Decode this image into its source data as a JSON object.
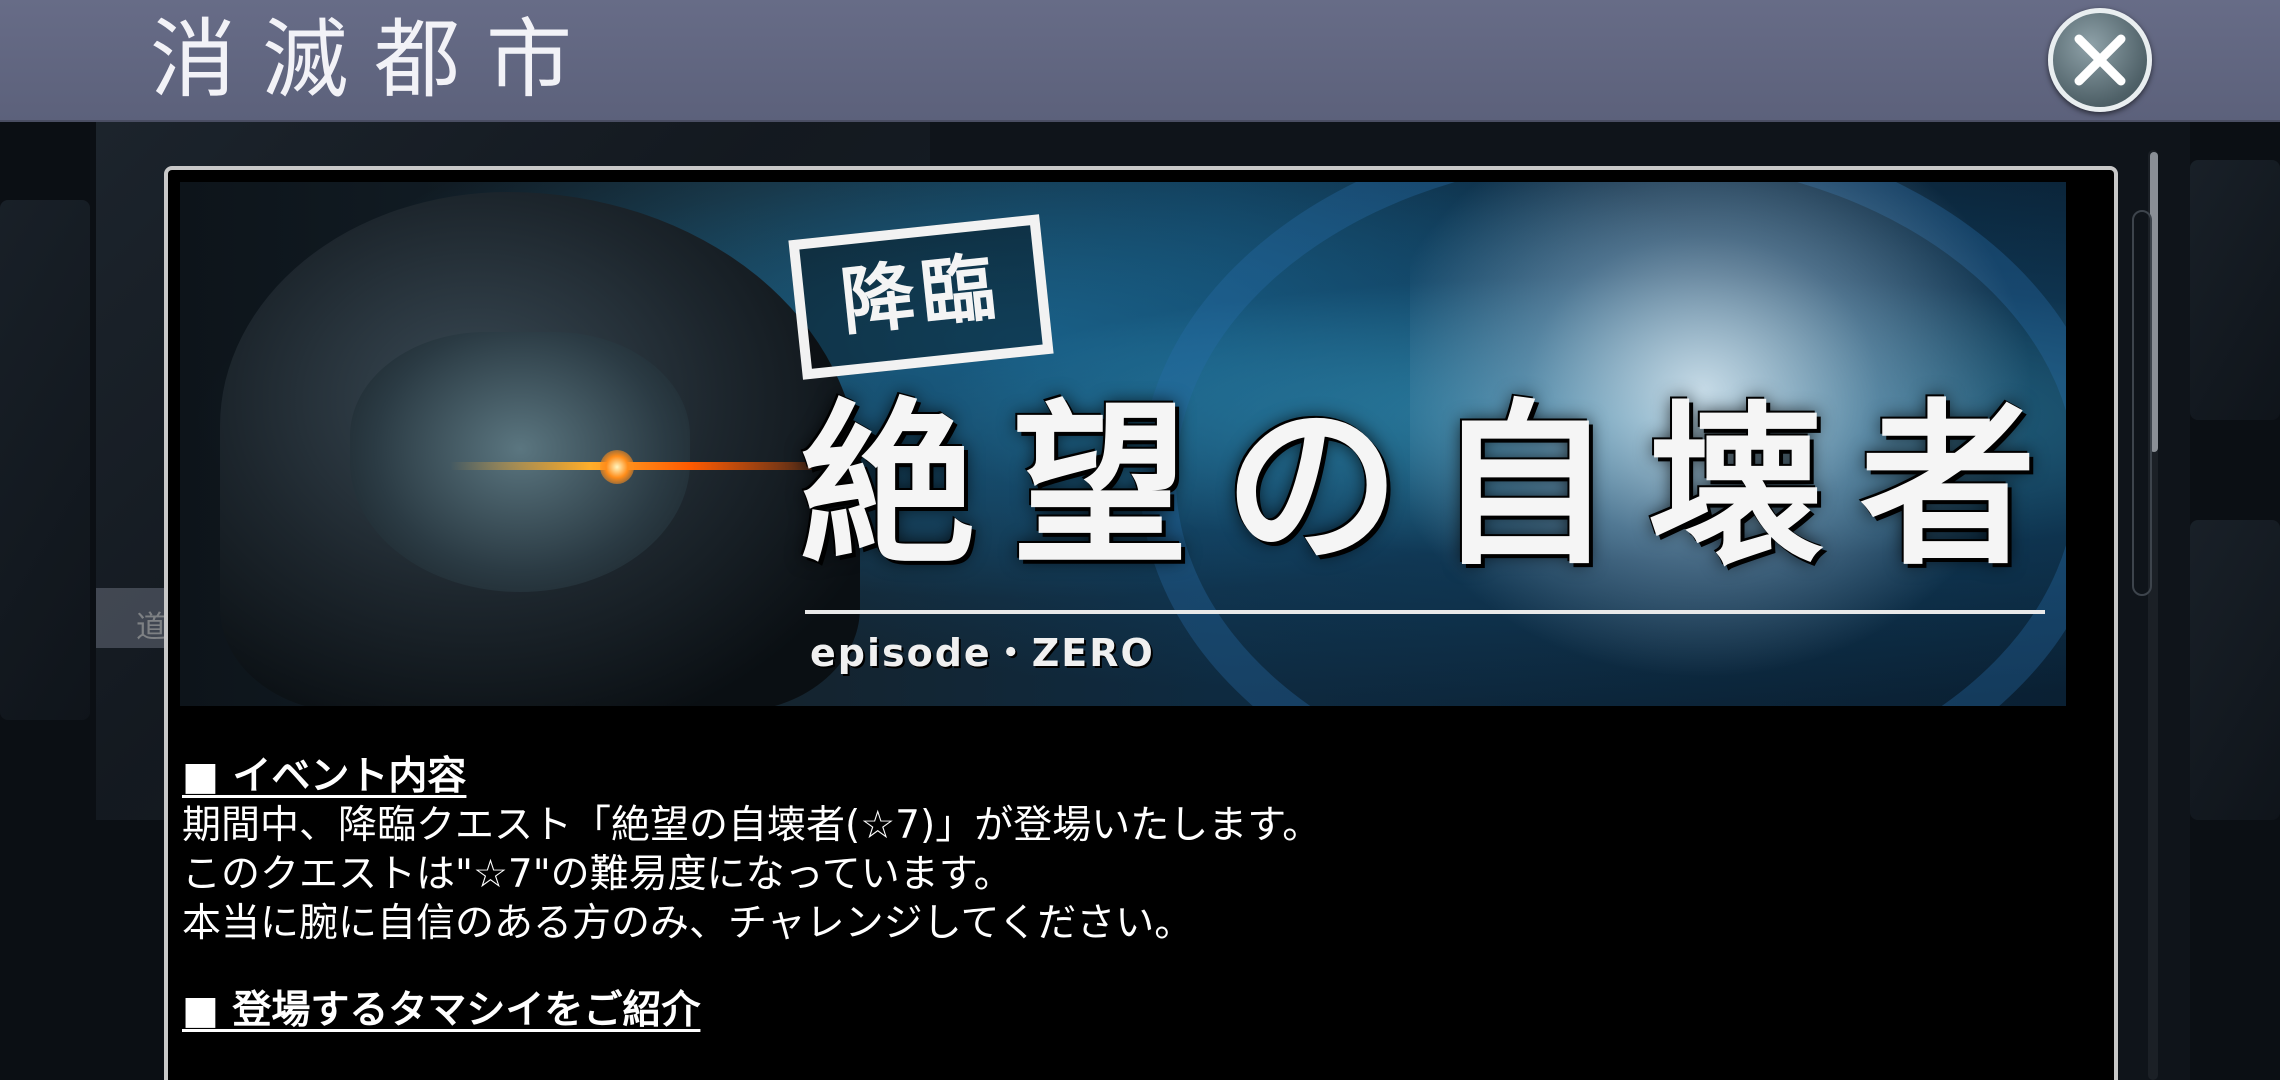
{
  "header": {
    "title": "消滅都市",
    "close_icon": "close-icon"
  },
  "background": {
    "left_strip_label": "道"
  },
  "banner": {
    "tag": "降臨",
    "title": "絶望の自壊者",
    "subtitle": "episode・ZERO"
  },
  "content": {
    "sections": [
      {
        "heading": "■ イベント内容",
        "lines": [
          "期間中、降臨クエスト「絶望の自壊者(☆7)」が登場いたします。",
          "このクエストは\"☆7\"の難易度になっています。",
          "本当に腕に自信のある方のみ、チャレンジしてください。"
        ]
      },
      {
        "heading": "■ 登場するタマシイをご紹介",
        "lines": []
      }
    ]
  },
  "colors": {
    "header_bg": "#5f647e",
    "modal_bg": "#000000",
    "modal_border": "#c8c8c8",
    "text": "#ffffff"
  }
}
